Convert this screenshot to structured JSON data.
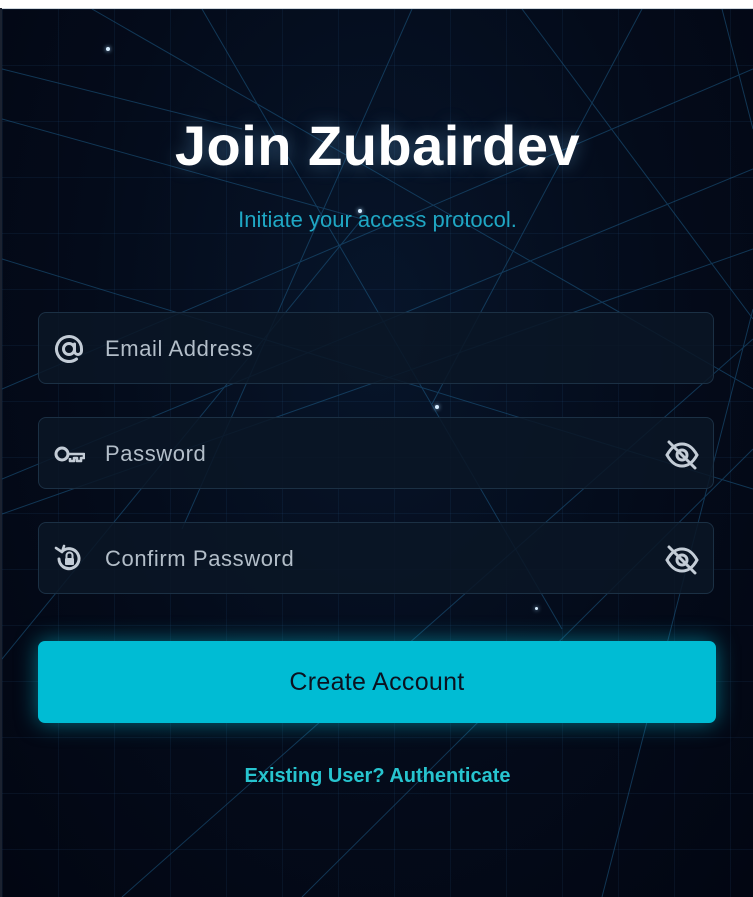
{
  "page": {
    "title": "Join Zubairdev",
    "subtitle": "Initiate your access protocol."
  },
  "form": {
    "email": {
      "placeholder": "Email Address",
      "value": "",
      "icon": "at-sign-icon"
    },
    "password": {
      "placeholder": "Password",
      "value": "",
      "icon": "key-icon",
      "toggle_icon": "eye-off-icon"
    },
    "confirm_password": {
      "placeholder": "Confirm Password",
      "value": "",
      "icon": "lock-reset-icon",
      "toggle_icon": "eye-off-icon"
    },
    "submit_label": "Create Account",
    "login_link": "Existing User? Authenticate"
  },
  "colors": {
    "background": "#030a18",
    "accent": "#00bcd4",
    "subtitle": "#1fa7c4",
    "link": "#27c4cf",
    "title": "#ffffff"
  }
}
